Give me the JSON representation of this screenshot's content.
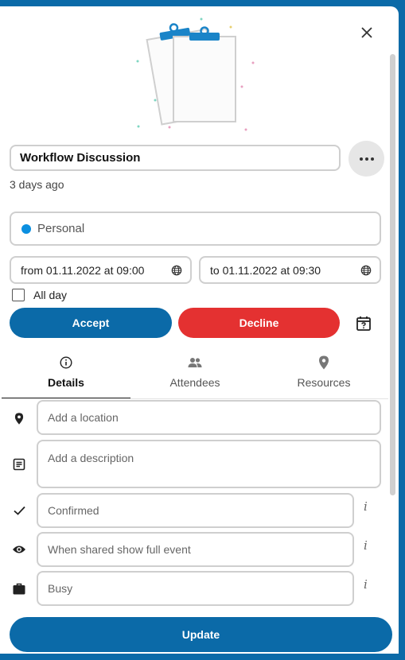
{
  "event": {
    "title": "Workflow Discussion",
    "modified": "3 days ago"
  },
  "calendar": {
    "name": "Personal",
    "color": "#0b8fe0"
  },
  "dates": {
    "from": "from 01.11.2022 at 09:00",
    "to": "to 01.11.2022 at 09:30"
  },
  "allday_label": "All day",
  "actions": {
    "accept": "Accept",
    "decline": "Decline"
  },
  "tabs": [
    {
      "label": "Details",
      "icon": "info-icon"
    },
    {
      "label": "Attendees",
      "icon": "people-icon"
    },
    {
      "label": "Resources",
      "icon": "map-marker-icon"
    }
  ],
  "fields": {
    "location_placeholder": "Add a location",
    "description_placeholder": "Add a description",
    "status": "Confirmed",
    "access": "When shared show full event",
    "availability": "Busy",
    "info_glyph": "i"
  },
  "update_label": "Update",
  "colors": {
    "primary": "#0b6aa8",
    "danger": "#e43131"
  }
}
